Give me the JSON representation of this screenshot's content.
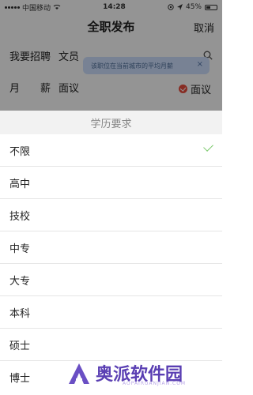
{
  "status_bar": {
    "carrier": "中国移动",
    "time": "14:28",
    "battery_percent": "45%",
    "battery_level": 0.45
  },
  "navbar": {
    "title": "全职发布",
    "cancel_label": "取消"
  },
  "form": {
    "job_label": "我要招聘",
    "job_value": "文员",
    "salary_label_chars": [
      "月",
      "薪"
    ],
    "salary_value": "面议",
    "tooltip_text": "该职位在当前城市的平均月薪",
    "tooltip_close": "×",
    "negotiable_label": "面议"
  },
  "sheet": {
    "title": "学历要求",
    "options": [
      {
        "label": "不限",
        "selected": true
      },
      {
        "label": "高中",
        "selected": false
      },
      {
        "label": "技校",
        "selected": false
      },
      {
        "label": "中专",
        "selected": false
      },
      {
        "label": "大专",
        "selected": false
      },
      {
        "label": "本科",
        "selected": false
      },
      {
        "label": "硕士",
        "selected": false
      },
      {
        "label": "博士",
        "selected": false
      }
    ]
  },
  "watermark": {
    "name": "奥派软件园",
    "url": "AOPAIRUANJIAN.COM"
  },
  "colors": {
    "accent_red": "#e94b3c",
    "check_green": "#7cc96c",
    "tooltip_bg": "#cfe1ff"
  }
}
